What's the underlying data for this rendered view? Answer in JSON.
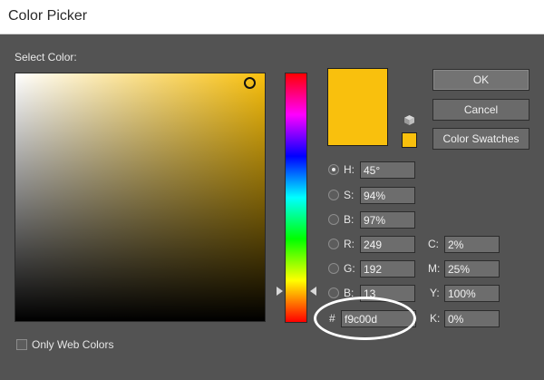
{
  "window": {
    "title": "Color Picker"
  },
  "picker": {
    "select_label": "Select Color:"
  },
  "current_color": "#f9c00d",
  "buttons": {
    "ok": "OK",
    "cancel": "Cancel",
    "swatches": "Color Swatches"
  },
  "hsb": [
    {
      "key": "H",
      "label": "H:",
      "value": "45°",
      "checked": true
    },
    {
      "key": "S",
      "label": "S:",
      "value": "94%",
      "checked": false
    },
    {
      "key": "B",
      "label": "B:",
      "value": "97%",
      "checked": false
    }
  ],
  "rgb": [
    {
      "key": "R",
      "label": "R:",
      "value": "249",
      "checked": false
    },
    {
      "key": "G",
      "label": "G:",
      "value": "192",
      "checked": false
    },
    {
      "key": "B",
      "label": "B:",
      "value": "13",
      "checked": false
    }
  ],
  "cmyk": [
    {
      "key": "C",
      "label": "C:",
      "value": "2%"
    },
    {
      "key": "M",
      "label": "M:",
      "value": "25%"
    },
    {
      "key": "Y",
      "label": "Y:",
      "value": "100%"
    },
    {
      "key": "K",
      "label": "K:",
      "value": "0%"
    }
  ],
  "hex": {
    "symbol": "#",
    "value": "f9c00d"
  },
  "web_colors": {
    "label": "Only Web Colors",
    "checked": false
  }
}
